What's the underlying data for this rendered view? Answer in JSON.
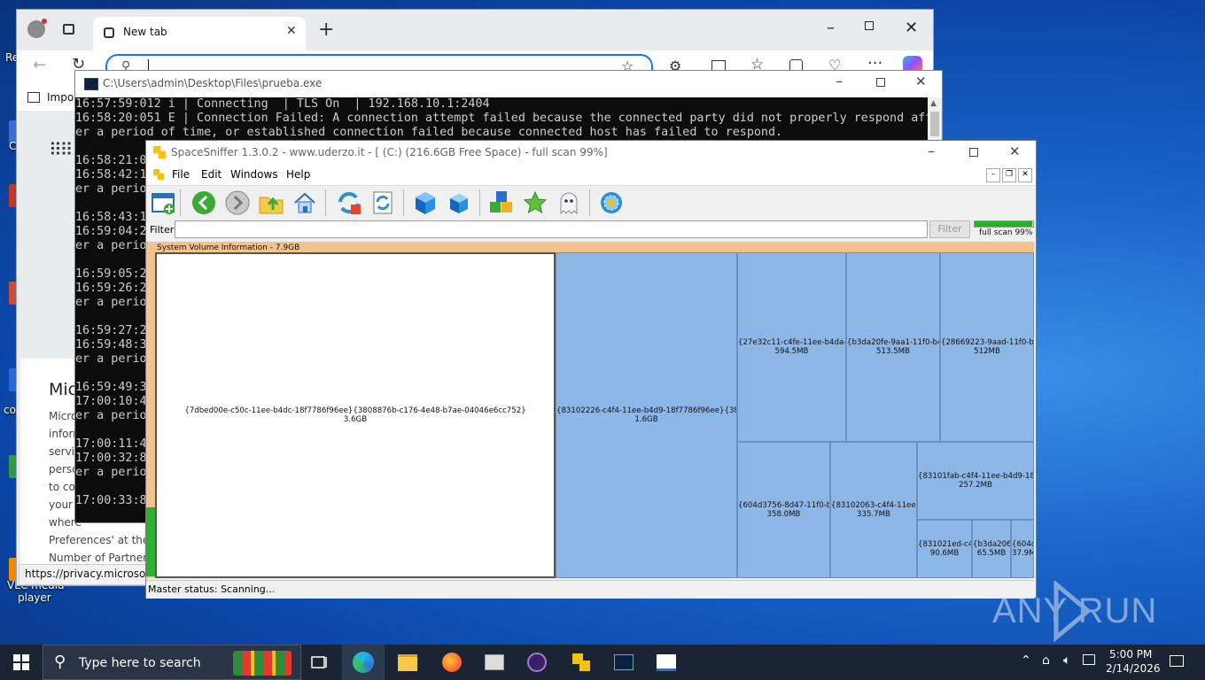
{
  "desktop": {
    "labels": [
      "Re",
      "C",
      "co",
      "VLC media",
      "player"
    ]
  },
  "edge": {
    "tab_title": "New tab",
    "fav_item": "Impor",
    "status_url": "https://privacy.microsoft.c",
    "privacy": {
      "heading": "Mic",
      "lines": [
        "Micro",
        "inform",
        "servic",
        "perso",
        "to co",
        "your",
        "where",
        "Preferences' at the",
        "Number of Partners"
      ]
    }
  },
  "console": {
    "title": "C:\\Users\\admin\\Desktop\\Files\\prueba.exe",
    "lines": [
      "16:57:59:012 i | Connecting  | TLS On  | 192.168.10.1:2404",
      "16:58:20:051 E | Connection Failed: A connection attempt failed because the connected party did not properly respond aft",
      "er a period of time, or established connection failed because connected host has failed to respond.",
      "",
      "16:58:21:0",
      "16:58:42:1",
      "er a perio",
      "",
      "16:58:43:1",
      "16:59:04:2",
      "er a perio",
      "",
      "16:59:05:2",
      "16:59:26:2",
      "er a perio",
      "",
      "16:59:27:2",
      "16:59:48:3",
      "er a perio",
      "",
      "16:59:49:3",
      "17:00:10:4",
      "er a perio",
      "",
      "17:00:11:4",
      "17:00:32:8",
      "er a perio",
      "",
      "17:00:33:8"
    ]
  },
  "spacesniffer": {
    "title": "SpaceSniffer 1.3.0.2 - www.uderzo.it - [ (C:) (216.6GB Free Space) - full scan 99%]",
    "menu": [
      "File",
      "Edit",
      "Windows",
      "Help"
    ],
    "filter_label": "Filter",
    "filter_button": "Filter",
    "progress_label": "full scan 99%",
    "progress": 0.99,
    "map_header": "System Volume Information - 7.9GB",
    "status": "Master status: Scanning...",
    "cells": [
      {
        "name": "{7dbed00e-c50c-11ee-b4dc-18f7786f96ee}{3808876b-c176-4e48-b7ae-04046e6cc752}",
        "size": "3.6GB"
      },
      {
        "name": "{83102226-c4f4-11ee-b4d9-18f7786f96ee}{38088",
        "size": "1.6GB"
      },
      {
        "name": "{27e32c11-c4fe-11ee-b4da-18",
        "size": "594.5MB"
      },
      {
        "name": "{b3da20fe-9aa1-11f0-b4f",
        "size": "513.5MB"
      },
      {
        "name": "{28669223-9aad-11f0-b4f",
        "size": "512MB"
      },
      {
        "name": "{604d3756-8d47-11f0-b4",
        "size": "358.0MB"
      },
      {
        "name": "{83102063-c4f4-11ee-b",
        "size": "335.7MB"
      },
      {
        "name": "{83101fab-c4f4-11ee-b4d9-18f7",
        "size": "257.2MB"
      },
      {
        "name": "{831021ed-c4f",
        "size": "90.6MB"
      },
      {
        "name": "{b3da206",
        "size": "65.5MB"
      },
      {
        "name": "{604d",
        "size": "37.9M"
      }
    ]
  },
  "taskbar": {
    "search_placeholder": "Type here to search",
    "time": "5:00 PM",
    "date": "2/14/2026"
  },
  "watermark": "ANY RUN"
}
